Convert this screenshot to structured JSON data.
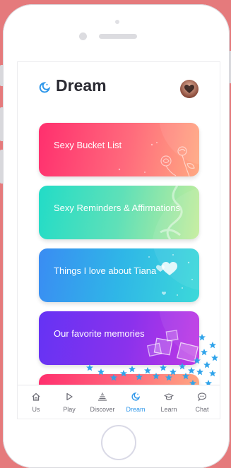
{
  "screen": {
    "title": "Dream"
  },
  "cards": [
    {
      "label": "Sexy Bucket List"
    },
    {
      "label": "Sexy Reminders & Affirmations"
    },
    {
      "label": "Things I love about Tiana"
    },
    {
      "label": "Our favorite memories"
    }
  ],
  "tabs": [
    {
      "label": "Us",
      "icon": "home-icon"
    },
    {
      "label": "Play",
      "icon": "play-icon"
    },
    {
      "label": "Discover",
      "icon": "discover-icon"
    },
    {
      "label": "Dream",
      "icon": "moon-icon",
      "active": true
    },
    {
      "label": "Learn",
      "icon": "graduation-cap-icon"
    },
    {
      "label": "Chat",
      "icon": "chat-bubble-icon"
    }
  ],
  "colors": {
    "accent": "#2e97ea",
    "background": "#e57a7c"
  }
}
